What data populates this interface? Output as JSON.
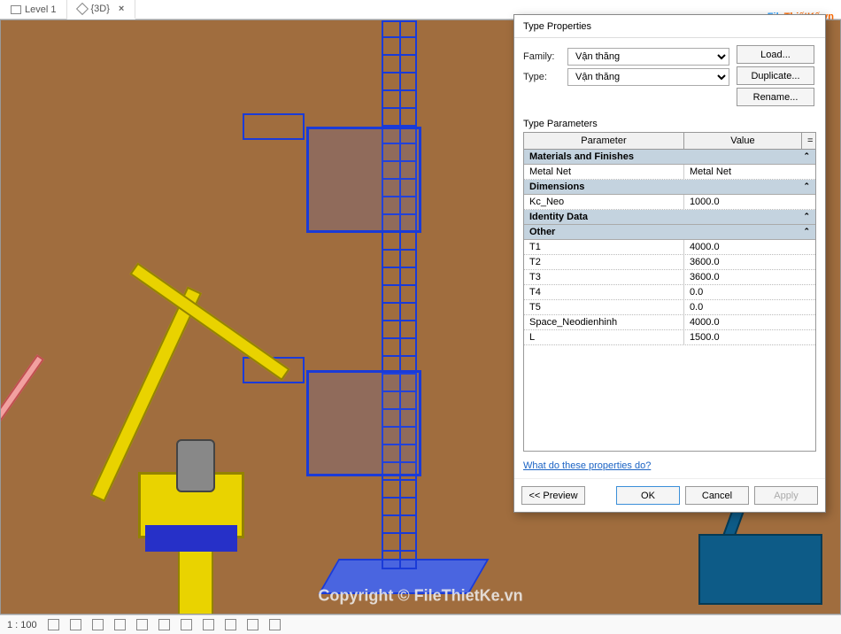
{
  "tabs": [
    {
      "label": "Level 1",
      "active": false
    },
    {
      "label": "{3D}",
      "active": true
    }
  ],
  "watermark": {
    "center": "Copyright © FileThietKe.vn",
    "logo_file": "File",
    "logo_thietke": "ThiếtKế",
    "logo_vn": ".vn"
  },
  "status": {
    "scale": "1 : 100"
  },
  "dialog": {
    "title": "Type Properties",
    "family_label": "Family:",
    "family_value": "Vận thăng",
    "type_label": "Type:",
    "type_value": "Vận thăng",
    "btn_load": "Load...",
    "btn_duplicate": "Duplicate...",
    "btn_rename": "Rename...",
    "type_parameters_label": "Type Parameters",
    "head_parameter": "Parameter",
    "head_value": "Value",
    "head_eq": "=",
    "groups": [
      {
        "name": "Materials and Finishes",
        "rows": [
          {
            "param": "Metal Net",
            "value": "Metal Net"
          }
        ]
      },
      {
        "name": "Dimensions",
        "rows": [
          {
            "param": "Kc_Neo",
            "value": "1000.0"
          }
        ]
      },
      {
        "name": "Identity Data",
        "rows": []
      },
      {
        "name": "Other",
        "rows": [
          {
            "param": "T1",
            "value": "4000.0"
          },
          {
            "param": "T2",
            "value": "3600.0"
          },
          {
            "param": "T3",
            "value": "3600.0"
          },
          {
            "param": "T4",
            "value": "0.0"
          },
          {
            "param": "T5",
            "value": "0.0"
          },
          {
            "param": "Space_Neodienhinh",
            "value": "4000.0"
          },
          {
            "param": "L",
            "value": "1500.0"
          }
        ]
      }
    ],
    "help_link": "What do these properties do?",
    "btn_preview": "<< Preview",
    "btn_ok": "OK",
    "btn_cancel": "Cancel",
    "btn_apply": "Apply"
  }
}
